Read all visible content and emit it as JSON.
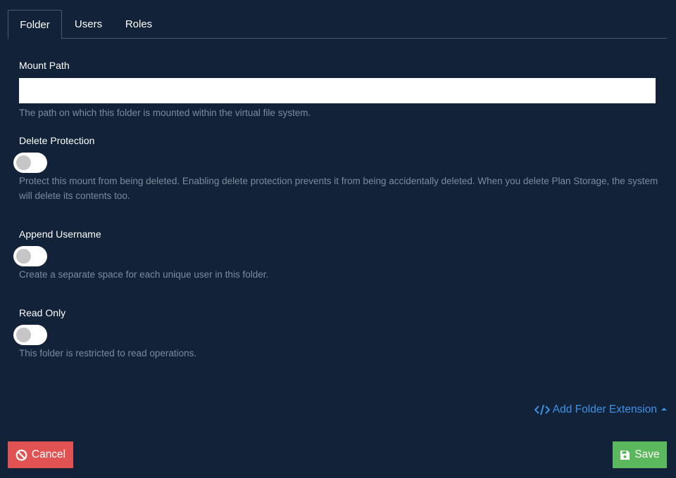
{
  "tabs": [
    {
      "label": "Folder",
      "active": true
    },
    {
      "label": "Users",
      "active": false
    },
    {
      "label": "Roles",
      "active": false
    }
  ],
  "mount_path": {
    "label": "Mount Path",
    "value": "",
    "help": "The path on which this folder is mounted within the virtual file system."
  },
  "delete_protection": {
    "label": "Delete Protection",
    "enabled": false,
    "help": "Protect this mount from being deleted. Enabling delete protection prevents it from being accidentally deleted. When you delete Plan Storage, the system will delete its contents too."
  },
  "append_username": {
    "label": "Append Username",
    "enabled": false,
    "help": "Create a separate space for each unique user in this folder."
  },
  "read_only": {
    "label": "Read Only",
    "enabled": false,
    "help": "This folder is restricted to read operations."
  },
  "extension": {
    "label": "Add Folder Extension",
    "icon": "code-icon",
    "caret_icon": "caret-up-icon"
  },
  "actions": {
    "cancel_label": "Cancel",
    "cancel_icon": "ban-icon",
    "save_label": "Save",
    "save_icon": "floppy-disk-icon"
  },
  "colors": {
    "background": "#112239",
    "link": "#3e92e6",
    "cancel": "#e15353",
    "save": "#5cb85c",
    "help_text": "#7d8c9c"
  }
}
